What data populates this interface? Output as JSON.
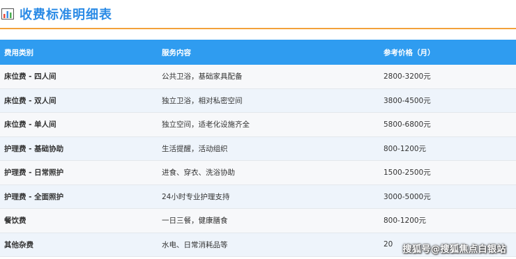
{
  "header": {
    "title": "收费标准明细表",
    "icon": "bar-chart-icon"
  },
  "table": {
    "columns": [
      "费用类别",
      "服务内容",
      "参考价格（月）"
    ],
    "rows": [
      [
        "床位费 - 四人间",
        "公共卫浴，基础家具配备",
        "2800-3200元"
      ],
      [
        "床位费 - 双人间",
        "独立卫浴，相对私密空间",
        "3800-4500元"
      ],
      [
        "床位费 - 单人间",
        "独立空间，适老化设施齐全",
        "5800-6800元"
      ],
      [
        "护理费 - 基础协助",
        "生活提醒，活动组织",
        "800-1200元"
      ],
      [
        "护理费 - 日常照护",
        "进食、穿衣、洗浴协助",
        "1500-2500元"
      ],
      [
        "护理费 - 全面照护",
        "24小时专业护理支持",
        "3000-5000元"
      ],
      [
        "餐饮费",
        "一日三餐，健康膳食",
        "800-1200元"
      ],
      [
        "其他杂费",
        "水电、日常消耗品等",
        "20"
      ]
    ]
  },
  "watermark": "搜狐号@搜狐焦点白银站",
  "colors": {
    "title": "#2b8be6",
    "header_bg": "#2f9cf0",
    "divider": "#f3a13a"
  }
}
